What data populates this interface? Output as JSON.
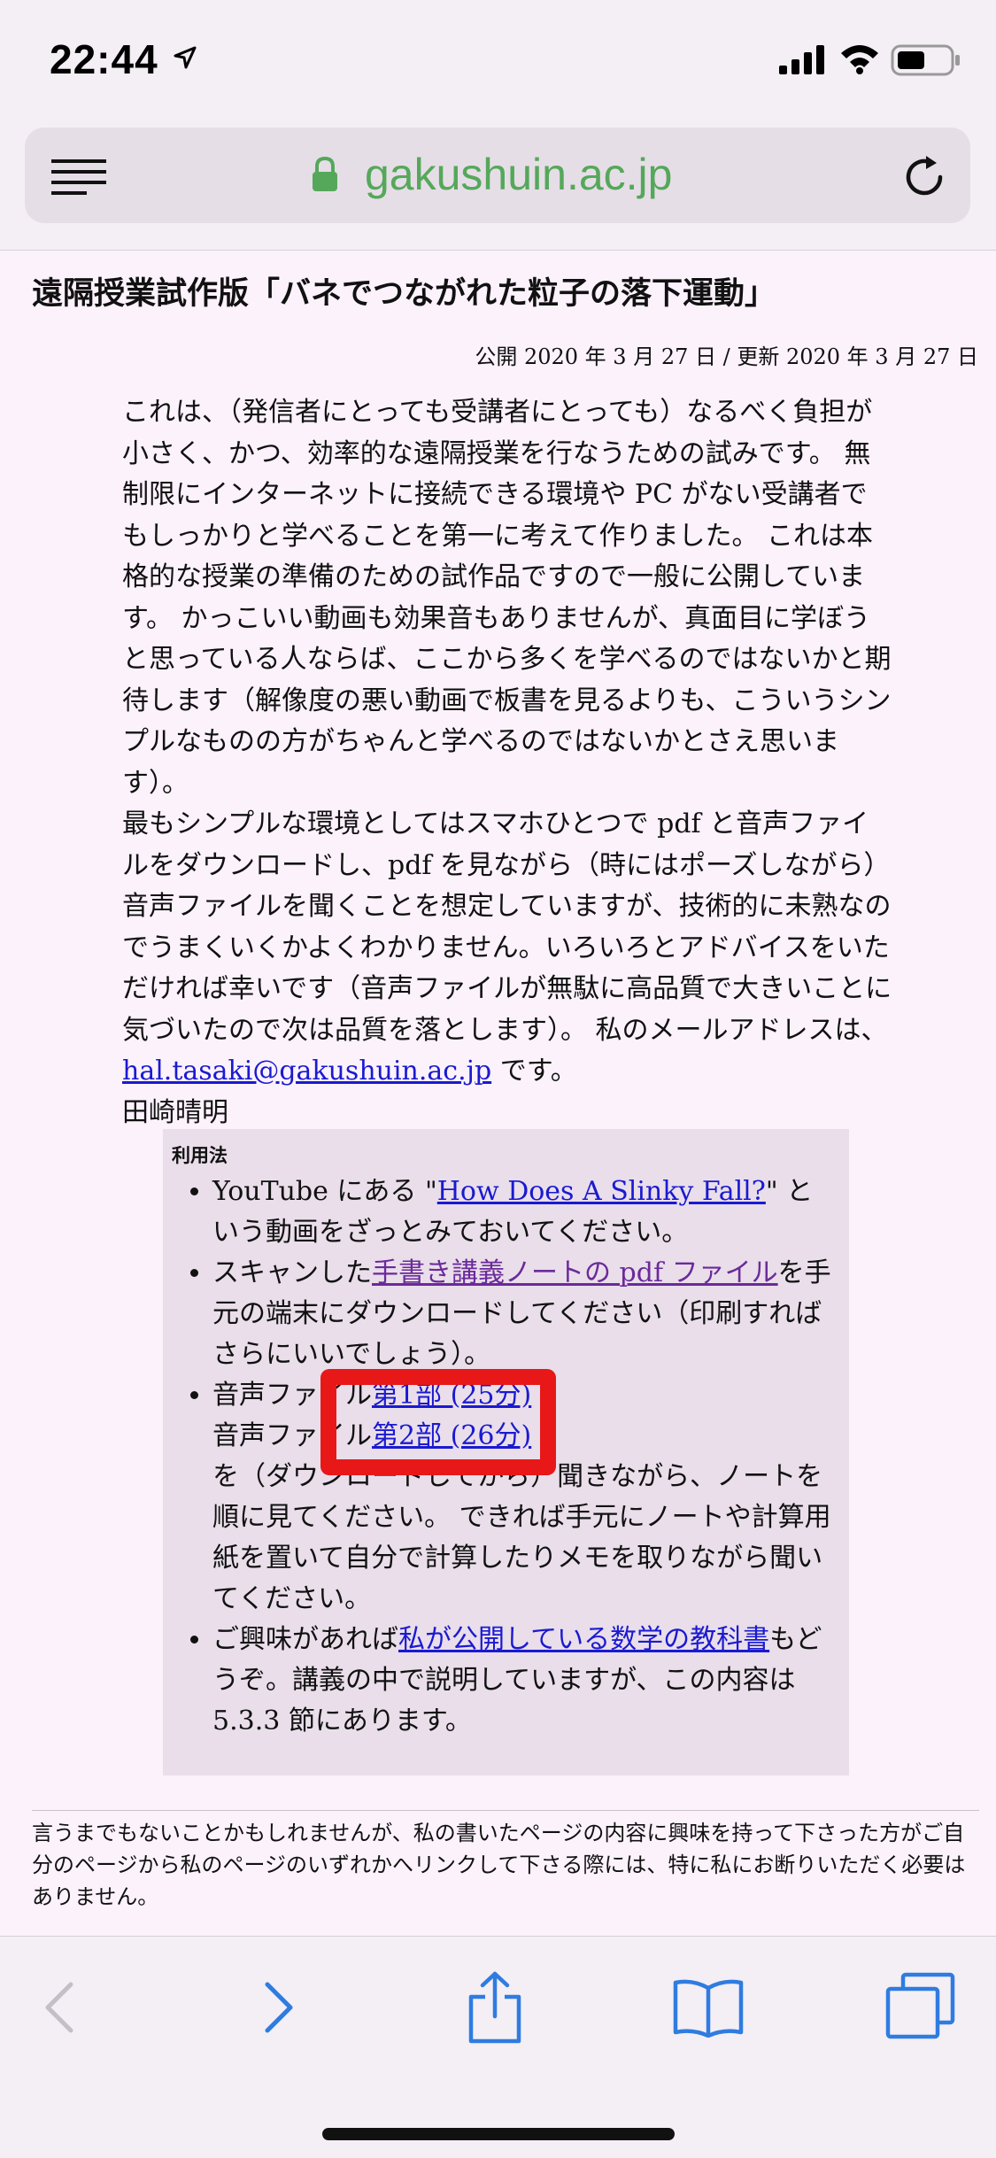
{
  "status_bar": {
    "time": "22:44"
  },
  "browser": {
    "url": "gakushuin.ac.jp"
  },
  "page": {
    "title": "遠隔授業試作版「バネでつながれた粒子の落下運動」",
    "published": "公開 2020 年 3 月 27 日 / 更新 2020 年 3 月 27 日",
    "intro": {
      "p1": "これは、（発信者にとっても受講者にとっても）なるべく負担が小さく、かつ、効率的な遠隔授業を行なうための試みです。 無制限にインターネットに接続できる環境や PC がない受講者でもしっかりと学べることを第一に考えて作りました。 これは本格的な授業の準備のための試作品ですので一般に公開しています。 かっこいい動画も効果音もありませんが、真面目に学ぼうと思っている人ならば、ここから多くを学べるのではないかと期待します（解像度の悪い動画で板書を見るよりも、こういうシンプルなものの方がちゃんと学べるのではないかとさえ思います）。",
      "p2_before": "最もシンプルな環境としてはスマホひとつで pdf と音声ファイルをダウンロードし、pdf を見ながら（時にはポーズしながら）音声ファイルを聞くことを想定していますが、技術的に未熟なのでうまくいくかよくわかりません。いろいろとアドバイスをいただければ幸いです（音声ファイルが無駄に高品質で大きいことに気づいたので次は品質を落とします）。 私のメールアドレスは、",
      "email": "hal.tasaki@gakushuin.ac.jp",
      "p2_after": " です。",
      "author": "田崎晴明"
    },
    "usage": {
      "title": "利用法",
      "item1_before": "YouTube にある \"",
      "item1_link": "How Does A Slinky Fall?",
      "item1_after": "\" という動画をざっとみておいてください。",
      "item2_before": "スキャンした",
      "item2_link": "手書き講義ノートの pdf ファイル",
      "item2_after": "を手元の端末にダウンロードしてください（印刷すればさらにいいでしょう）。",
      "item3_prefix1": "音声ファイル",
      "item3_link1": "第1部 (25分)",
      "item3_prefix2": "音声ファイル",
      "item3_link2": "第2部 (26分)",
      "item3_after": "を（ダウンロードしてから）聞きながら、ノートを順に見てください。 できれば手元にノートや計算用紙を置いて自分で計算したりメモを取りながら聞いてください。",
      "item4_before": "ご興味があれば",
      "item4_link": "私が公開している数学の教科書",
      "item4_after": "もどうぞ。講義の中で説明していますが、この内容は 5.3.3 節にあります。"
    },
    "footer_note": "言うまでもないことかもしれませんが、私の書いたページの内容に興味を持って下さった方がご自分のページから私のページのいずれかへリンクして下さる際には、特に私にお断りいただく必要はありません。"
  },
  "colors": {
    "link": "#1a1ad0",
    "visited_link": "#6b2a9a",
    "highlight": "#e81818",
    "accent": "#2f7ce0"
  }
}
